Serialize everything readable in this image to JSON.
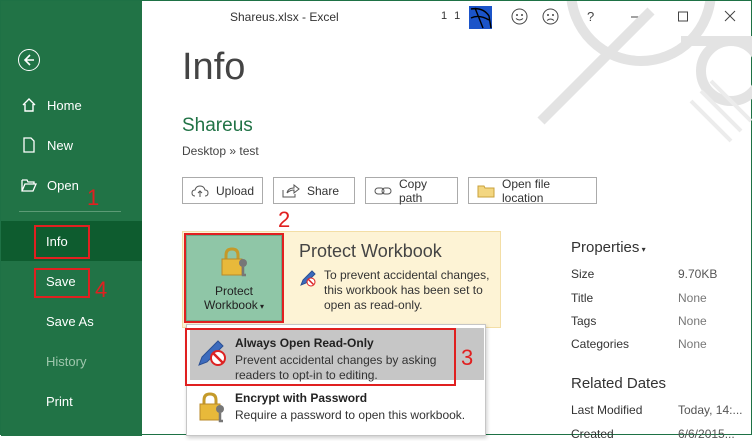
{
  "window": {
    "title": "Shareus.xlsx  -  Excel",
    "user_name": "1 1"
  },
  "sidebar": {
    "items": [
      {
        "label": "Home"
      },
      {
        "label": "New"
      },
      {
        "label": "Open"
      },
      {
        "label": "Info"
      },
      {
        "label": "Save"
      },
      {
        "label": "Save As"
      },
      {
        "label": "History"
      },
      {
        "label": "Print"
      }
    ]
  },
  "main": {
    "page_title": "Info",
    "doc_name": "Shareus",
    "breadcrumb": "Desktop » test",
    "actions": [
      {
        "label": "Upload"
      },
      {
        "label": "Share"
      },
      {
        "label": "Copy path"
      },
      {
        "label": "Open file location"
      }
    ],
    "protect": {
      "button_line1": "Protect",
      "button_line2": "Workbook",
      "heading": "Protect Workbook",
      "description": "To prevent accidental changes, this workbook has been set to open as read-only."
    },
    "dropdown": [
      {
        "title": "Always Open Read-Only",
        "desc": "Prevent accidental changes by asking readers to opt-in to editing."
      },
      {
        "title": "Encrypt with Password",
        "desc": "Require a password to open this workbook."
      }
    ]
  },
  "properties": {
    "title": "Properties",
    "rows": [
      {
        "key": "Size",
        "value": "9.70KB"
      },
      {
        "key": "Title",
        "value": "None"
      },
      {
        "key": "Tags",
        "value": "None"
      },
      {
        "key": "Categories",
        "value": "None"
      }
    ],
    "related_title": "Related Dates",
    "dates": [
      {
        "key": "Last Modified",
        "value": "Today, 14:..."
      },
      {
        "key": "Created",
        "value": "6/6/2015..."
      }
    ]
  },
  "annotations": [
    "1",
    "2",
    "3",
    "4"
  ],
  "colors": {
    "accent": "#217346",
    "annotation": "#e02020",
    "protect_bg": "#fdf3d5"
  }
}
